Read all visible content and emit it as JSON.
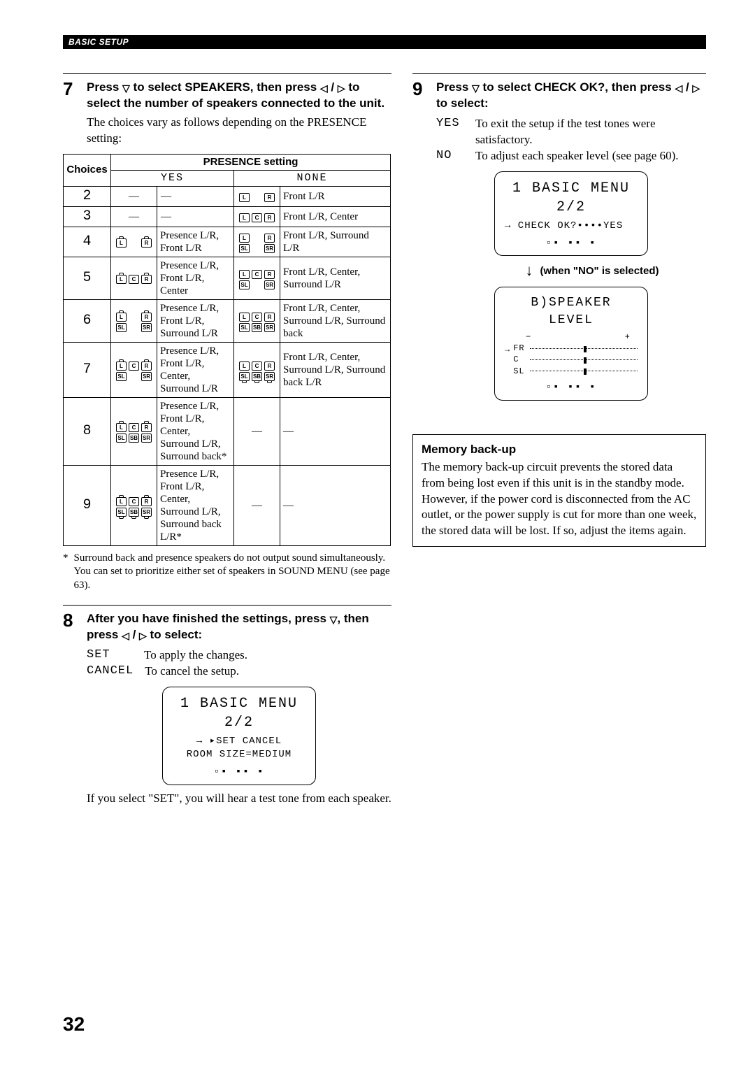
{
  "header": "BASIC SETUP",
  "glyphs": {
    "down": "▽",
    "left": "◁",
    "right": "▷",
    "arrow_down_filled": "↓",
    "play": "▸",
    "right_arrow_small": "→",
    "dash": "—"
  },
  "step7": {
    "num": "7",
    "instr_a": "Press ",
    "instr_b": " to select SPEAKERS, then press ",
    "instr_c": " / ",
    "instr_d": " to select the number of speakers connected to the unit.",
    "text": "The choices vary as follows depending on the PRESENCE setting:",
    "table": {
      "h_choices": "Choices",
      "h_presence": "PRESENCE setting",
      "h_yes": "YES",
      "h_none": "NONE",
      "rows": [
        {
          "n": "2",
          "yd": "",
          "nd": "Front L/R"
        },
        {
          "n": "3",
          "yd": "",
          "nd": "Front L/R, Center"
        },
        {
          "n": "4",
          "yd": "Presence L/R, Front L/R",
          "nd": "Front L/R, Surround L/R"
        },
        {
          "n": "5",
          "yd": "Presence L/R, Front L/R, Center",
          "nd": "Front L/R, Center, Surround L/R"
        },
        {
          "n": "6",
          "yd": "Presence L/R, Front L/R, Surround L/R",
          "nd": "Front L/R, Center, Surround L/R, Surround back"
        },
        {
          "n": "7",
          "yd": "Presence L/R, Front L/R, Center, Surround L/R",
          "nd": "Front L/R, Center, Surround L/R, Surround back L/R"
        },
        {
          "n": "8",
          "yd": "Presence L/R, Front L/R, Center, Surround L/R, Surround back*",
          "nd": ""
        },
        {
          "n": "9",
          "yd": "Presence L/R, Front L/R, Center, Surround L/R, Surround back L/R*",
          "nd": ""
        }
      ]
    },
    "footnote_star": "*",
    "footnote": "Surround back and presence speakers do not output sound simultaneously. You can set to prioritize either set of speakers in SOUND MENU (see page 63)."
  },
  "step8": {
    "num": "8",
    "instr_a": "After you have finished the settings, press ",
    "instr_b": ", then press ",
    "instr_c": " / ",
    "instr_d": " to select:",
    "opts": [
      {
        "key": "SET",
        "val": "To apply the changes."
      },
      {
        "key": "CANCEL",
        "val": "To cancel the setup."
      }
    ],
    "lcd": {
      "title": "1 BASIC MENU 2/2",
      "line1_pre": "→   ",
      "line1_play": "▸",
      "line1_a": "SET",
      "line1_b": " CANCEL",
      "line2": "ROOM SIZE=MEDIUM"
    },
    "post": "If you select \"SET\", you will hear a test tone from each speaker."
  },
  "step9": {
    "num": "9",
    "instr_a": "Press ",
    "instr_b": " to select CHECK OK?, then press ",
    "instr_c": " / ",
    "instr_d": " to select:",
    "opts": [
      {
        "key": "YES",
        "val": "To exit the setup if the test tones were satisfactory."
      },
      {
        "key": "NO",
        "val": "To adjust each speaker level (see page 60)."
      }
    ],
    "lcd1": {
      "title": "1 BASIC MENU 2/2",
      "line1": "→ CHECK OK?••••YES"
    },
    "noselect": "(when \"NO\" is selected)",
    "lcd2": {
      "title": "B)SPEAKER LEVEL",
      "labels": [
        "FR",
        "C",
        "SL"
      ],
      "minus": "−",
      "plus": "+",
      "arrow": "→"
    }
  },
  "memory": {
    "title": "Memory back-up",
    "body": "The memory back-up circuit prevents the stored data from being lost even if this unit is in the standby mode. However, if the power cord is disconnected from the AC outlet, or the power supply is cut for more than one week, the stored data will be lost. If so, adjust the items again."
  },
  "page_number": "32"
}
